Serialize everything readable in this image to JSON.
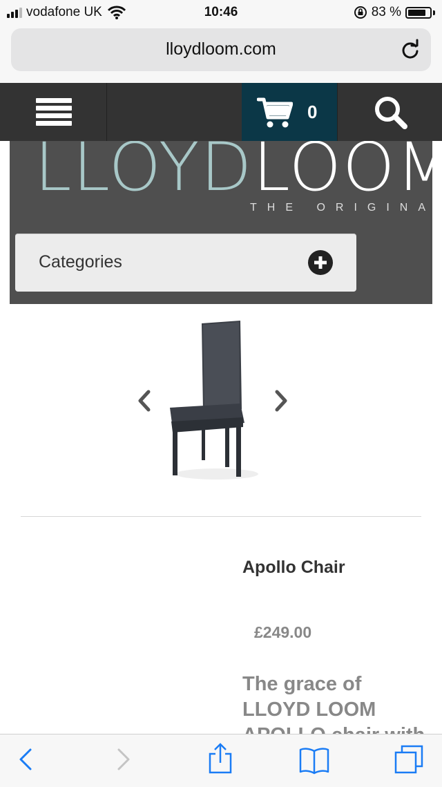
{
  "status_bar": {
    "carrier": "vodafone UK",
    "time": "10:46",
    "battery_percent": "83 %",
    "battery_level": 0.83
  },
  "browser": {
    "url": "lloydloom.com"
  },
  "site_nav": {
    "cart_count": "0"
  },
  "banner": {
    "logo_part1": "LLOYD",
    "logo_part2": "LOOM",
    "tagline": "THE ORIGINAL",
    "categories_label": "Categories"
  },
  "product": {
    "title": "Apollo Chair",
    "price": "£249.00",
    "description": "The grace of LLOYD LOOM APOLLO chair with"
  },
  "colors": {
    "nav_bg": "#333333",
    "cart_bg": "#0b3747",
    "banner_bg": "#4f4f4f",
    "logo_accent": "#a8c8c8",
    "ios_blue": "#1a7cf5"
  }
}
